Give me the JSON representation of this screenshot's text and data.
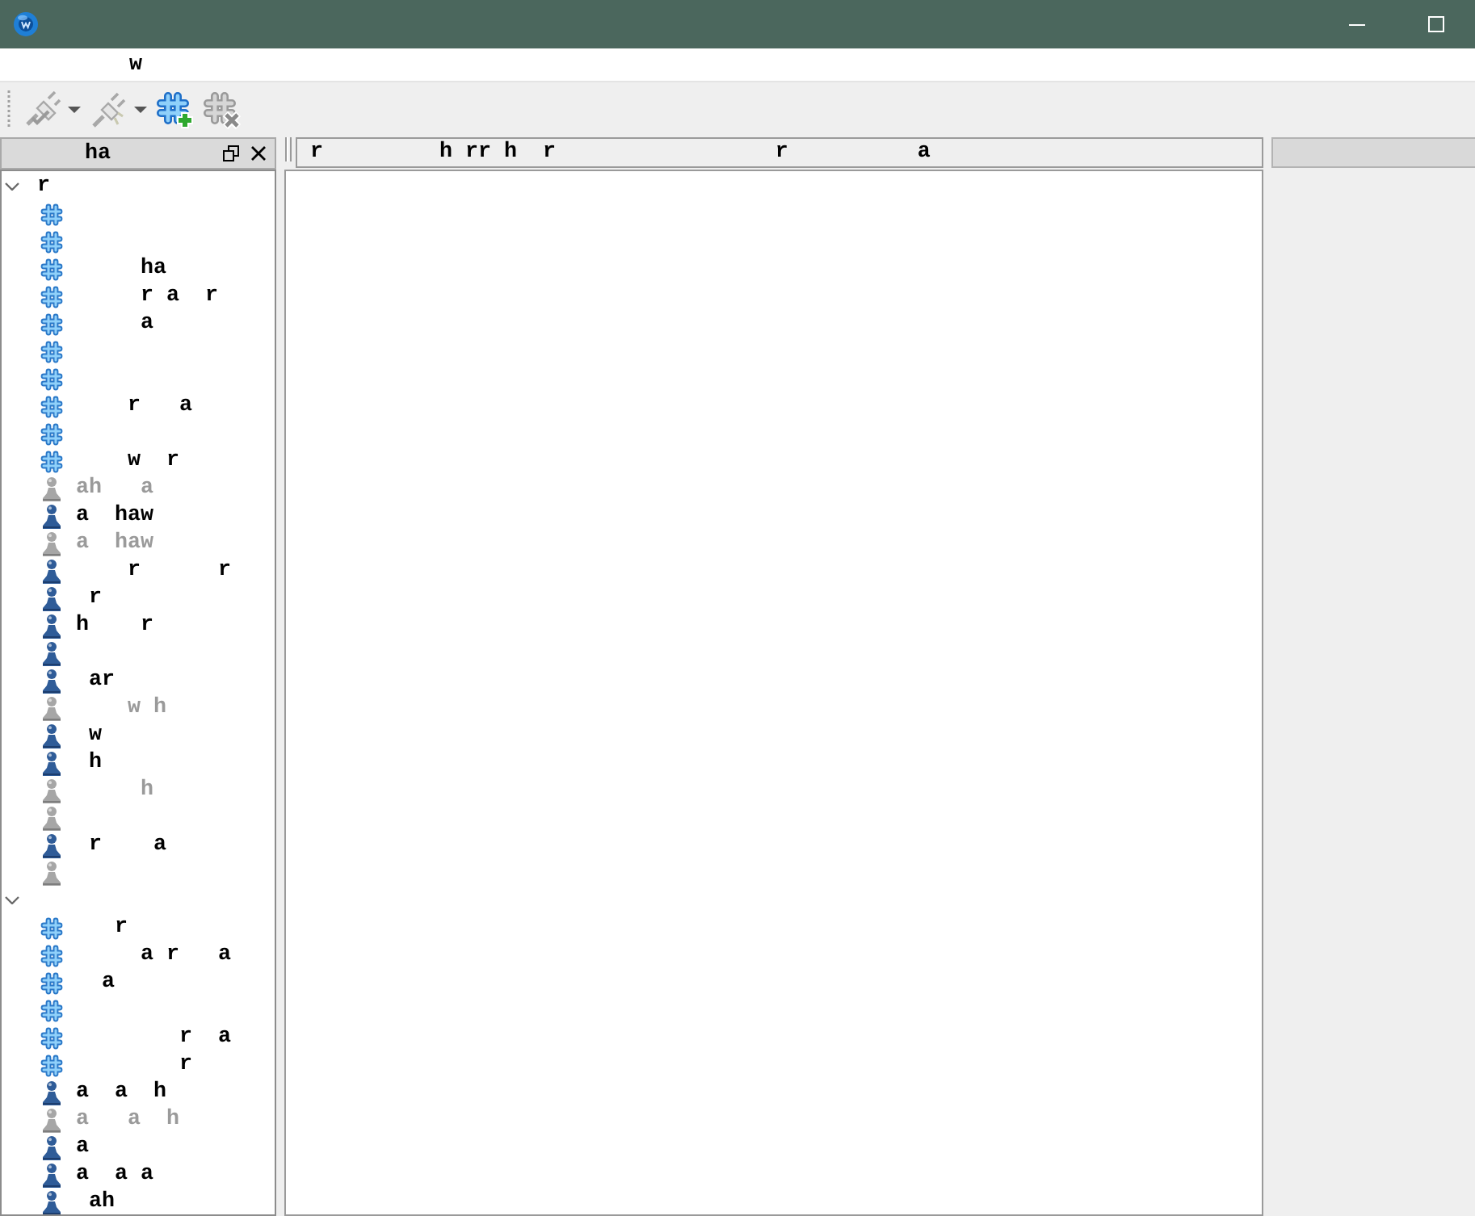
{
  "menu_bar": {
    "items": [
      "         w"
    ]
  },
  "toolbar": {
    "buttons": [
      {
        "kind": "connect",
        "disabled": true,
        "dropdown": true
      },
      {
        "kind": "disconnect",
        "disabled": true,
        "dropdown": true
      },
      {
        "kind": "join",
        "disabled": false,
        "dropdown": false
      },
      {
        "kind": "part",
        "disabled": true,
        "dropdown": false
      }
    ]
  },
  "side_panel": {
    "title": "ha",
    "tree": [
      {
        "label": "r",
        "expanded": true,
        "children": [
          {
            "kind": "channel"
          },
          {
            "kind": "channel"
          },
          {
            "kind": "channel",
            "label": "     ha"
          },
          {
            "kind": "channel",
            "label": "     r a  r"
          },
          {
            "kind": "channel",
            "label": "     a"
          },
          {
            "kind": "channel"
          },
          {
            "kind": "channel"
          },
          {
            "kind": "channel",
            "label": "    r   a"
          },
          {
            "kind": "channel"
          },
          {
            "kind": "channel",
            "label": "    w  r"
          },
          {
            "kind": "user",
            "away": true,
            "label": "ah   a"
          },
          {
            "kind": "user",
            "away": false,
            "label": "a  haw"
          },
          {
            "kind": "user",
            "away": true,
            "label": "a  haw"
          },
          {
            "kind": "user",
            "away": false,
            "label": "    r      r"
          },
          {
            "kind": "user",
            "away": false,
            "label": " r"
          },
          {
            "kind": "user",
            "away": false,
            "label": "h    r"
          },
          {
            "kind": "user",
            "away": false
          },
          {
            "kind": "user",
            "away": false,
            "label": " ar"
          },
          {
            "kind": "user",
            "away": true,
            "label": "    w h"
          },
          {
            "kind": "user",
            "away": false,
            "label": " w"
          },
          {
            "kind": "user",
            "away": false,
            "label": " h"
          },
          {
            "kind": "user",
            "away": true,
            "label": "     h"
          },
          {
            "kind": "user",
            "away": true
          },
          {
            "kind": "user",
            "away": false,
            "label": " r    a"
          },
          {
            "kind": "user",
            "away": true
          }
        ]
      },
      {
        "expanded": true,
        "children": [
          {
            "kind": "channel",
            "label": "   r"
          },
          {
            "kind": "channel",
            "label": "     a r   a"
          },
          {
            "kind": "channel",
            "label": "  a"
          },
          {
            "kind": "channel"
          },
          {
            "kind": "channel",
            "label": "        r  a"
          },
          {
            "kind": "channel",
            "label": "        r"
          },
          {
            "kind": "user",
            "away": false,
            "label": "a  a  h"
          },
          {
            "kind": "user",
            "away": true,
            "label": "a   a  h"
          },
          {
            "kind": "user",
            "away": false,
            "label": "a"
          },
          {
            "kind": "user",
            "away": false,
            "label": "a  a a"
          },
          {
            "kind": "user",
            "away": false,
            "label": " ah"
          }
        ]
      }
    ]
  },
  "topic_bar": {
    "topic": "r         h rr h  r                 r          a"
  }
}
